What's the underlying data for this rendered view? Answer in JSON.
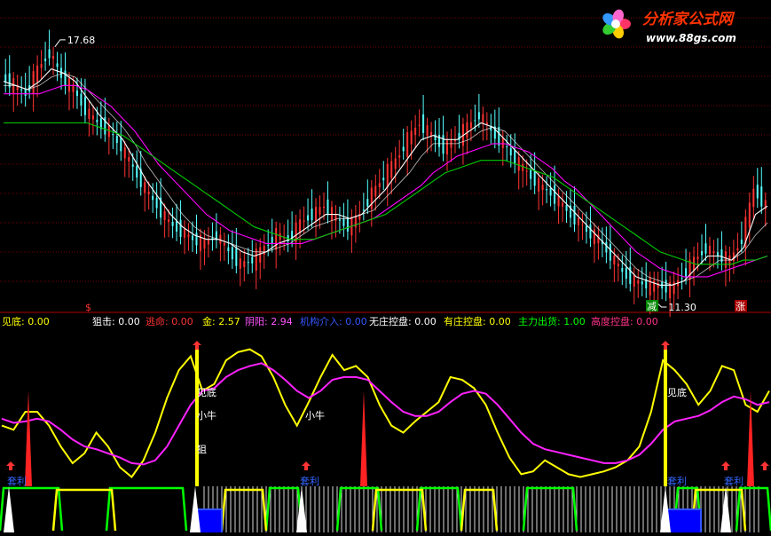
{
  "logo": {
    "text": "分析家公式网",
    "url": "www.88gs.com"
  },
  "colors": {
    "background": "#000000",
    "grid": "#7a0000",
    "up_candle": "#ff3333",
    "down_candle": "#54ffff",
    "ma_short": "#ffffff",
    "ma_mid": "#ffff00",
    "ma_long": "#ff00ff",
    "ma_longest": "#00cc00"
  },
  "chart_data": [
    {
      "type": "candlestick",
      "panel": "price",
      "price_high_label": "17.68",
      "price_low_label": "11.30",
      "markers": [
        "$",
        "减",
        "涨"
      ],
      "series": [
        {
          "role": "close",
          "values": [
            16.4,
            16.2,
            16.0,
            16.6,
            17.0,
            16.4,
            16.1,
            15.6,
            15.3,
            15.1,
            14.7,
            14.2,
            13.7,
            13.3,
            12.9,
            12.7,
            12.5,
            12.4,
            12.6,
            12.2,
            11.9,
            12.0,
            12.3,
            12.6,
            12.5,
            12.9,
            13.1,
            13.3,
            13.0,
            12.8,
            13.1,
            13.6,
            14.0,
            14.4,
            14.9,
            15.3,
            15.0,
            14.7,
            14.9,
            15.2,
            15.5,
            15.1,
            14.8,
            14.4,
            14.1,
            13.8,
            13.6,
            13.3,
            13.0,
            12.7,
            12.5,
            12.1,
            11.7,
            11.5,
            11.4,
            11.4,
            11.3,
            11.6,
            12.0,
            12.3,
            12.1,
            12.0,
            12.5,
            13.7,
            13.3
          ]
        },
        {
          "role": "ma5",
          "values": [
            16.3,
            16.2,
            16.1,
            16.3,
            16.6,
            16.5,
            16.3,
            15.9,
            15.5,
            15.2,
            14.9,
            14.4,
            13.9,
            13.5,
            13.1,
            12.8,
            12.6,
            12.5,
            12.5,
            12.4,
            12.2,
            12.1,
            12.2,
            12.4,
            12.5,
            12.7,
            12.9,
            13.1,
            13.1,
            13.0,
            13.1,
            13.4,
            13.7,
            14.1,
            14.5,
            14.9,
            15.0,
            14.9,
            14.9,
            15.1,
            15.3,
            15.2,
            14.9,
            14.6,
            14.3,
            14.0,
            13.7,
            13.4,
            13.1,
            12.8,
            12.5,
            12.2,
            11.9,
            11.6,
            11.5,
            11.4,
            11.4,
            11.5,
            11.8,
            12.1,
            12.1,
            12.0,
            12.3,
            13.1,
            13.3
          ]
        },
        {
          "role": "ma10",
          "values": [
            16.2,
            16.2,
            16.1,
            16.2,
            16.4,
            16.5,
            16.4,
            16.1,
            15.8,
            15.5,
            15.2,
            14.8,
            14.3,
            13.9,
            13.5,
            13.1,
            12.8,
            12.6,
            12.5,
            12.4,
            12.3,
            12.2,
            12.2,
            12.3,
            12.4,
            12.6,
            12.8,
            12.9,
            13.0,
            13.0,
            13.1,
            13.2,
            13.5,
            13.8,
            14.1,
            14.5,
            14.8,
            14.8,
            14.8,
            14.9,
            15.1,
            15.2,
            15.1,
            14.8,
            14.5,
            14.2,
            13.9,
            13.6,
            13.3,
            13.0,
            12.7,
            12.4,
            12.1,
            11.8,
            11.6,
            11.5,
            11.4,
            11.5,
            11.6,
            11.8,
            12.0,
            12.0,
            12.2,
            12.6,
            12.9
          ]
        },
        {
          "role": "ma20",
          "values": [
            16.0,
            16.0,
            16.0,
            16.0,
            16.1,
            16.2,
            16.2,
            16.1,
            15.9,
            15.7,
            15.4,
            15.1,
            14.7,
            14.3,
            14.0,
            13.7,
            13.4,
            13.1,
            12.9,
            12.7,
            12.6,
            12.5,
            12.4,
            12.4,
            12.4,
            12.4,
            12.5,
            12.6,
            12.7,
            12.8,
            12.9,
            13.0,
            13.2,
            13.4,
            13.6,
            13.8,
            14.1,
            14.3,
            14.5,
            14.6,
            14.7,
            14.8,
            14.8,
            14.7,
            14.6,
            14.4,
            14.2,
            13.9,
            13.7,
            13.4,
            13.1,
            12.8,
            12.5,
            12.2,
            12.0,
            11.8,
            11.7,
            11.6,
            11.6,
            11.6,
            11.7,
            11.8,
            11.9,
            12.0,
            12.1
          ]
        },
        {
          "role": "ma60",
          "values": [
            15.3,
            15.3,
            15.3,
            15.3,
            15.3,
            15.3,
            15.3,
            15.3,
            15.2,
            15.1,
            15.0,
            14.8,
            14.6,
            14.4,
            14.2,
            14.0,
            13.8,
            13.6,
            13.4,
            13.2,
            13.0,
            12.8,
            12.7,
            12.6,
            12.5,
            12.5,
            12.5,
            12.6,
            12.7,
            12.8,
            12.9,
            13.0,
            13.1,
            13.3,
            13.5,
            13.7,
            13.9,
            14.1,
            14.2,
            14.3,
            14.4,
            14.4,
            14.4,
            14.3,
            14.2,
            14.1,
            14.0,
            13.8,
            13.6,
            13.4,
            13.2,
            13.0,
            12.8,
            12.6,
            12.4,
            12.2,
            12.1,
            12.0,
            11.9,
            11.9,
            11.9,
            11.9,
            12.0,
            12.0,
            12.1
          ]
        }
      ],
      "ylim": [
        11.0,
        18.0
      ]
    },
    {
      "type": "line",
      "panel": "indicator",
      "legend": [
        {
          "label": "见底:",
          "value": "0.00",
          "color": "#ffff00"
        },
        {
          "label": "狙击:",
          "value": "0.00",
          "color": "#ffffff"
        },
        {
          "label": "逃命:",
          "value": "0.00",
          "color": "#ff3333"
        },
        {
          "label": "金:",
          "value": "2.57",
          "color": "#ffff00"
        },
        {
          "label": "阴阳:",
          "value": "2.94",
          "color": "#ff55ff"
        },
        {
          "label": "机构介入:",
          "value": "0.00",
          "color": "#3355ff"
        },
        {
          "label": "无庄控盘:",
          "value": "0.00",
          "color": "#ffffff"
        },
        {
          "label": "有庄控盘:",
          "value": "0.00",
          "color": "#ffff00"
        },
        {
          "label": "主力出货:",
          "value": "1.00",
          "color": "#00ff00"
        },
        {
          "label": "高度控盘:",
          "value": "0.00",
          "color": "#ff3388"
        }
      ],
      "annotations": [
        "见底",
        "小牛",
        "小牛",
        "狙",
        "见底",
        "套利",
        "套利",
        "套利",
        "套利"
      ],
      "series": [
        {
          "role": "yellow",
          "values": [
            45,
            42,
            55,
            55,
            45,
            30,
            18,
            25,
            40,
            30,
            15,
            8,
            20,
            40,
            65,
            85,
            95,
            70,
            75,
            92,
            98,
            100,
            95,
            80,
            60,
            45,
            62,
            80,
            96,
            85,
            88,
            80,
            60,
            45,
            40,
            48,
            55,
            62,
            80,
            78,
            72,
            60,
            40,
            22,
            10,
            12,
            20,
            15,
            10,
            8,
            10,
            12,
            15,
            20,
            30,
            55,
            92,
            85,
            75,
            60,
            70,
            88,
            85,
            60,
            55,
            70
          ]
        },
        {
          "role": "magenta",
          "values": [
            50,
            47,
            48,
            50,
            48,
            42,
            35,
            30,
            28,
            25,
            22,
            18,
            17,
            20,
            30,
            45,
            60,
            70,
            72,
            80,
            85,
            88,
            90,
            85,
            78,
            70,
            65,
            70,
            78,
            80,
            80,
            78,
            70,
            62,
            55,
            52,
            52,
            55,
            62,
            68,
            70,
            68,
            60,
            50,
            40,
            32,
            28,
            26,
            24,
            22,
            20,
            18,
            18,
            20,
            24,
            32,
            42,
            48,
            50,
            52,
            56,
            62,
            66,
            64,
            60,
            62
          ]
        }
      ],
      "ylim": [
        0,
        110
      ]
    }
  ]
}
